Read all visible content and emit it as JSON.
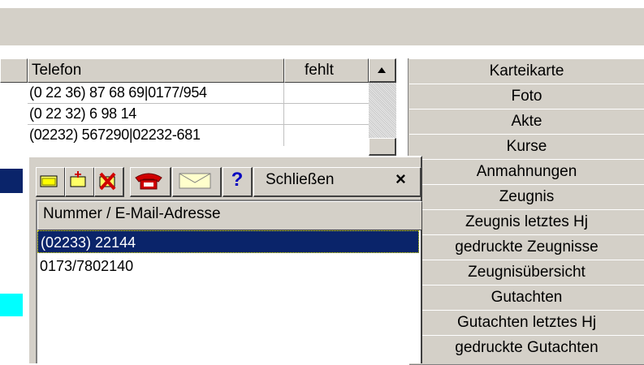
{
  "grid": {
    "columns": {
      "telefon": "Telefon",
      "fehlt": "fehlt"
    },
    "rows": [
      {
        "telefon": "(0 22 36) 87 68 69|0177/954",
        "fehlt": ""
      },
      {
        "telefon": "(0 22 32) 6 98 14",
        "fehlt": ""
      },
      {
        "telefon": "(02232) 567290|02232-681",
        "fehlt": ""
      }
    ]
  },
  "menu": {
    "items": [
      "Karteikarte",
      "Foto",
      "Akte",
      "Kurse",
      "Anmahnungen",
      "Zeugnis",
      "Zeugnis letztes Hj",
      "gedruckte Zeugnisse",
      "Zeugnisübersicht",
      "Gutachten",
      "Gutachten letztes Hj",
      "gedruckte Gutachten"
    ]
  },
  "popup": {
    "close_label": "Schließen",
    "close_x": "×",
    "help": "?",
    "list_header": "Nummer / E-Mail-Adresse",
    "entries": [
      "(02233) 22144",
      "0173/7802140"
    ]
  },
  "colors": {
    "selection": "#0a246a",
    "row_highlight": "#0a246a",
    "cyan_marker": "#00ffff",
    "face": "#d4d0c8"
  }
}
